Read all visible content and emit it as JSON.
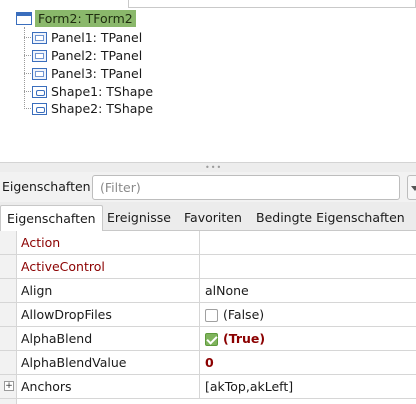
{
  "tree": {
    "root": {
      "label": "Form2: TForm2",
      "icon": "form-icon"
    },
    "children": [
      {
        "label": "Panel1: TPanel",
        "icon": "panel-icon"
      },
      {
        "label": "Panel2: TPanel",
        "icon": "panel-icon"
      },
      {
        "label": "Panel3: TPanel",
        "icon": "panel-icon"
      },
      {
        "label": "Shape1: TShape",
        "icon": "shape-icon"
      },
      {
        "label": "Shape2: TShape",
        "icon": "shape-icon"
      }
    ]
  },
  "filter": {
    "label": "Eigenschaften",
    "placeholder": "(Filter)",
    "value": ""
  },
  "tabs": [
    {
      "label": "Eigenschaften",
      "active": true
    },
    {
      "label": "Ereignisse",
      "active": false
    },
    {
      "label": "Favoriten",
      "active": false
    },
    {
      "label": "Bedingte Eigenschaften",
      "active": false
    }
  ],
  "properties": [
    {
      "name": "Action",
      "value": "",
      "kind": "event"
    },
    {
      "name": "ActiveControl",
      "value": "",
      "kind": "event"
    },
    {
      "name": "Align",
      "value": "alNone",
      "kind": "normal"
    },
    {
      "name": "AllowDropFiles",
      "value": "(False)",
      "kind": "checkbox",
      "checked": false
    },
    {
      "name": "AlphaBlend",
      "value": "(True)",
      "kind": "checkbox",
      "checked": true,
      "changed": true
    },
    {
      "name": "AlphaBlendValue",
      "value": "0",
      "kind": "normal",
      "changed": true
    },
    {
      "name": "Anchors",
      "value": "[akTop,akLeft]",
      "kind": "set",
      "expander": "+"
    }
  ],
  "colors": {
    "selected_node_bg": "#8ab86b",
    "event_property": "#8b0000",
    "checkbox_checked": "#7fb35c"
  }
}
